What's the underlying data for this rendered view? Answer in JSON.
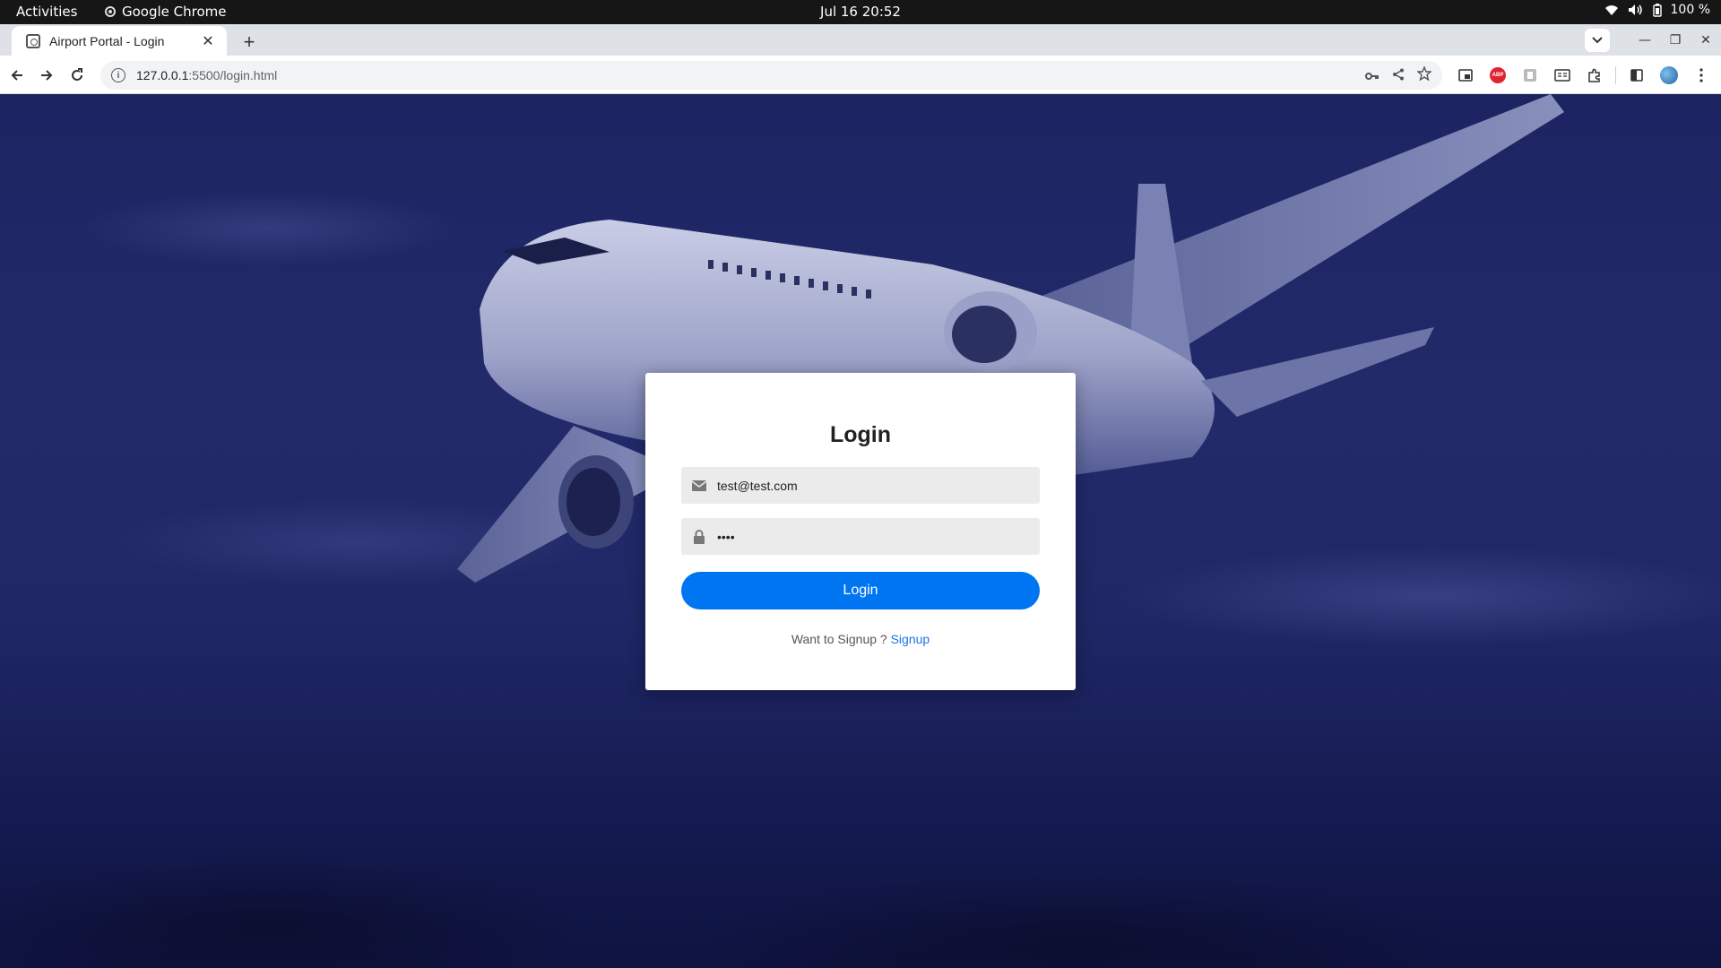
{
  "os": {
    "activities": "Activities",
    "app_name": "Google Chrome",
    "clock": "Jul 16  20:52",
    "battery": "100 %"
  },
  "browser": {
    "tab_title": "Airport Portal - Login",
    "url_host": "127.0.0.1",
    "url_rest": ":5500/login.html"
  },
  "login": {
    "heading": "Login",
    "email_value": "test@test.com",
    "password_value": "••••",
    "button_label": "Login",
    "signup_prompt": "Want to Signup ?",
    "signup_link": "Signup"
  },
  "colors": {
    "button": "#0075f2",
    "link": "#1a73e8",
    "background_overlay": "#1f2766"
  }
}
